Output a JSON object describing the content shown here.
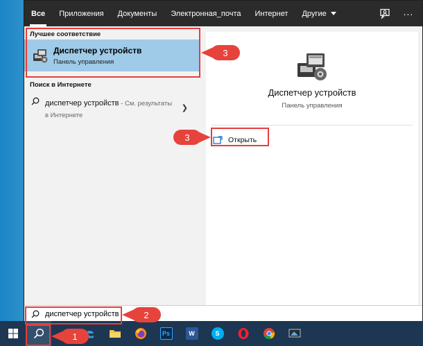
{
  "tabs": [
    {
      "label": "Все"
    },
    {
      "label": "Приложения"
    },
    {
      "label": "Документы"
    },
    {
      "label": "Электронная_почта"
    },
    {
      "label": "Интернет"
    },
    {
      "label": "Другие"
    }
  ],
  "header_icons": [
    "feedback-icon",
    "more-options-icon"
  ],
  "left_panel": {
    "best_match_heading": "Лучшее соответствие",
    "best_match": {
      "title": "Диспетчер устройств",
      "subtitle": "Панель управления",
      "icon": "device-manager-icon"
    },
    "web_heading": "Поиск в Интернете",
    "web_result": {
      "query": "диспетчер устройств",
      "hint_line1": " - См. результаты",
      "hint_line2": "в Интернете"
    }
  },
  "right_panel": {
    "title": "Диспетчер устройств",
    "subtitle": "Панель управления",
    "open_label": "Открыть"
  },
  "search_bar": {
    "value": "диспетчер устройств"
  },
  "callouts": {
    "step1": "1",
    "step2": "2",
    "step3_left": "3",
    "step3_right": "3"
  },
  "taskbar": {
    "items": [
      "windows-start-icon",
      "search-icon",
      "edge-icon",
      "file-explorer-icon",
      "firefox-icon",
      "photoshop-icon",
      "word-icon",
      "skype-icon",
      "opera-icon",
      "chrome-icon",
      "app-icon"
    ],
    "photoshop_label": "Ps",
    "word_label": "W",
    "skype_label": "S"
  },
  "colors": {
    "accent_highlight": "#9fcbe8",
    "annotation_red": "#e6433c",
    "tab_bar_bg": "#2b2b2b",
    "taskbar_bg": "#1d3651"
  }
}
